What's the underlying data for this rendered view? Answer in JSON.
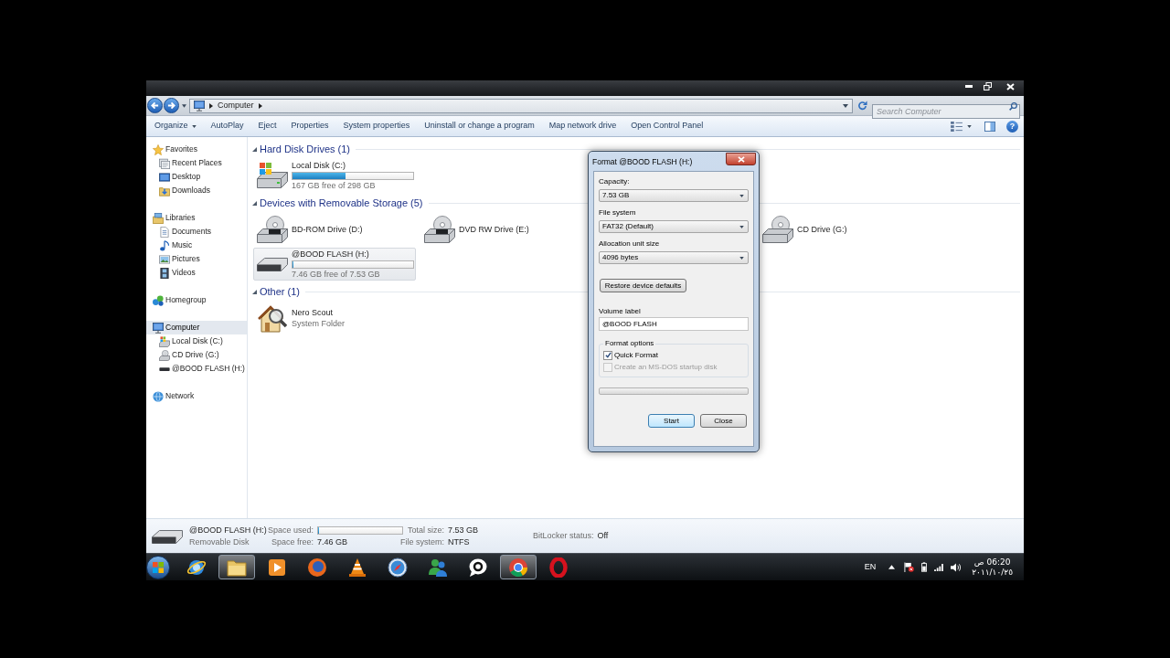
{
  "address_bar": {
    "path": [
      "Computer"
    ],
    "search": {
      "placeholder": "Search Computer"
    }
  },
  "toolbar": {
    "buttons": [
      {
        "label": "Organize",
        "menu": true
      },
      {
        "label": "AutoPlay",
        "menu": false
      },
      {
        "label": "Eject",
        "menu": false
      },
      {
        "label": "Properties",
        "menu": false
      },
      {
        "label": "System properties",
        "menu": false
      },
      {
        "label": "Uninstall or change a program",
        "menu": false
      },
      {
        "label": "Map network drive",
        "menu": false
      },
      {
        "label": "Open Control Panel",
        "menu": false
      }
    ],
    "help": "?"
  },
  "sidebar": {
    "sections": [
      {
        "label": "Favorites",
        "kind": "star",
        "selected": false,
        "children": [
          {
            "label": "Recent Places",
            "kind": "recent",
            "selected": false
          },
          {
            "label": "Desktop",
            "kind": "desktop",
            "selected": false
          },
          {
            "label": "Downloads",
            "kind": "downloads",
            "selected": false
          }
        ]
      },
      {
        "label": "Libraries",
        "kind": "libraries",
        "selected": false,
        "children": [
          {
            "label": "Documents",
            "kind": "documents",
            "selected": false
          },
          {
            "label": "Music",
            "kind": "music",
            "selected": false
          },
          {
            "label": "Pictures",
            "kind": "pictures",
            "selected": false
          },
          {
            "label": "Videos",
            "kind": "videos",
            "selected": false
          }
        ]
      },
      {
        "label": "Homegroup",
        "kind": "homegroup",
        "selected": false
      },
      {
        "label": "Computer",
        "kind": "computer",
        "selected": true,
        "children": [
          {
            "label": "Local Disk (C:)",
            "kind": "harddisk",
            "selected": false
          },
          {
            "label": "CD Drive (G:)",
            "kind": "cd",
            "selected": false
          },
          {
            "label": "@BOOD FLASH (H:)",
            "kind": "flash",
            "selected": false
          }
        ]
      },
      {
        "label": "Network",
        "kind": "network",
        "selected": false
      }
    ]
  },
  "content": {
    "groups": [
      {
        "title": "Hard Disk Drives (1)",
        "expanded": true,
        "items": [
          {
            "name": "Local Disk (C:)",
            "kind": "harddisk",
            "level": 0.44,
            "detail": "167 GB free of 298 GB",
            "selected": false
          }
        ]
      },
      {
        "title": "Devices with Removable Storage (5)",
        "expanded": true,
        "items": [
          {
            "name": "BD-ROM Drive (D:)",
            "kind": "bd",
            "selected": false
          },
          {
            "name": "DVD RW Drive (E:)",
            "kind": "dvd",
            "selected": false
          },
          {
            "name": "CD Drive (G:)",
            "kind": "cd",
            "selected": false
          },
          {
            "name": "@BOOD FLASH (H:)",
            "kind": "flash",
            "level": 0.01,
            "detail": "7.46 GB free of 7.53 GB",
            "selected": true
          }
        ]
      },
      {
        "title": "Other (1)",
        "expanded": true,
        "items": [
          {
            "name": "Nero Scout",
            "kind": "folder_search",
            "detail": "System Folder",
            "selected": false
          }
        ]
      }
    ]
  },
  "dialog": {
    "title": "Format @BOOD FLASH (H:)",
    "fields": [
      {
        "label": "Capacity:",
        "value": "7.53 GB"
      },
      {
        "label": "File system",
        "value": "FAT32 (Default)"
      },
      {
        "label": "Allocation unit size",
        "value": "4096 bytes"
      }
    ],
    "restore_button": "Restore device defaults",
    "volume_label": {
      "label": "Volume label",
      "value": "@BOOD FLASH"
    },
    "format_options": {
      "title": "Format options",
      "options": [
        {
          "label": "Quick Format",
          "checked": true,
          "disabled": false
        },
        {
          "label": "Create an MS-DOS startup disk",
          "checked": false,
          "disabled": true
        }
      ]
    },
    "progress": {
      "level": 0
    },
    "buttons": [
      {
        "label": "Start",
        "default": true
      },
      {
        "label": "Close",
        "default": false
      }
    ]
  },
  "details": {
    "kind": "flash",
    "name": "@BOOD FLASH (H:)",
    "type": "Removable Disk",
    "fields": [
      {
        "label": "Space used:",
        "kind": "bar",
        "level": 0.01
      },
      {
        "label": "Space free:",
        "kind": "text",
        "value": "7.46 GB"
      },
      {
        "label": "Total size:",
        "kind": "text",
        "value": "7.53 GB"
      },
      {
        "label": "File system:",
        "kind": "text",
        "value": "NTFS"
      },
      {
        "label": "BitLocker status:",
        "kind": "text",
        "value": "Off"
      }
    ]
  },
  "taskbar": {
    "apps": [
      {
        "kind": "ebrowser",
        "running": false
      },
      {
        "kind": "folder",
        "running": true
      },
      {
        "kind": "player",
        "running": false
      },
      {
        "kind": "foxglobe",
        "running": false
      },
      {
        "kind": "cone",
        "running": false
      },
      {
        "kind": "compass",
        "running": false
      },
      {
        "kind": "buddies",
        "running": false
      },
      {
        "kind": "bubble",
        "running": false
      },
      {
        "kind": "wheel",
        "running": true
      },
      {
        "kind": "oring",
        "running": false
      }
    ],
    "tray": {
      "language": "EN",
      "time": "06:20 ص",
      "date": "٢٠١١/١٠/٢٥"
    }
  }
}
